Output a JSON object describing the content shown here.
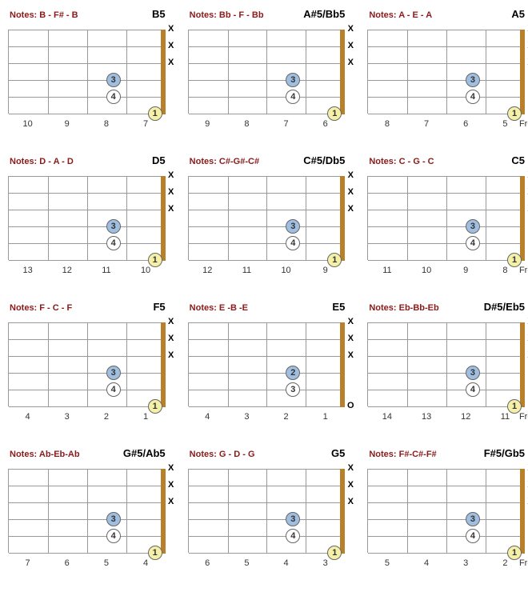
{
  "frets_label": "Frets",
  "chords": [
    {
      "notes": "Notes: B - F# - B",
      "name": "B5",
      "frets": [
        "10",
        "9",
        "8",
        "7"
      ],
      "endLabel": false,
      "open": null,
      "dots": [
        {
          "fret": 3,
          "string": 5,
          "finger": "4",
          "cls": "white"
        },
        {
          "fret": 3,
          "string": 4,
          "finger": "3",
          "cls": "blue"
        },
        {
          "fret": 0.15,
          "string": 6,
          "plus": false,
          "finger": "1",
          "cls": "yellow"
        }
      ],
      "mute": [
        1,
        2,
        3
      ]
    },
    {
      "notes": "Notes: Bb - F - Bb",
      "name": "A#5/Bb5",
      "frets": [
        "9",
        "8",
        "7",
        "6"
      ],
      "endLabel": false,
      "open": null,
      "dots": [
        {
          "fret": 3,
          "string": 5,
          "finger": "4",
          "cls": "white"
        },
        {
          "fret": 3,
          "string": 4,
          "finger": "3",
          "cls": "blue"
        },
        {
          "fret": 0.15,
          "string": 6,
          "plus": false,
          "finger": "1",
          "cls": "yellow"
        }
      ],
      "mute": [
        1,
        2,
        3
      ]
    },
    {
      "notes": "Notes: A - E - A",
      "name": "A5",
      "frets": [
        "8",
        "7",
        "6",
        "5"
      ],
      "endLabel": true,
      "open": null,
      "dots": [
        {
          "fret": 3,
          "string": 5,
          "finger": "4",
          "cls": "white"
        },
        {
          "fret": 3,
          "string": 4,
          "finger": "3",
          "cls": "blue"
        },
        {
          "fret": 0.15,
          "string": 6,
          "plus": false,
          "finger": "1",
          "cls": "yellow"
        }
      ],
      "mute": [
        1,
        2,
        3
      ]
    },
    {
      "notes": "Notes: D - A - D",
      "name": "D5",
      "frets": [
        "13",
        "12",
        "11",
        "10"
      ],
      "endLabel": false,
      "open": null,
      "dots": [
        {
          "fret": 3,
          "string": 5,
          "finger": "4",
          "cls": "white"
        },
        {
          "fret": 3,
          "string": 4,
          "finger": "3",
          "cls": "blue"
        },
        {
          "fret": 0.15,
          "string": 6,
          "plus": false,
          "finger": "1",
          "cls": "yellow"
        }
      ],
      "mute": [
        1,
        2,
        3
      ]
    },
    {
      "notes": "Notes: C#-G#-C#",
      "name": "C#5/Db5",
      "frets": [
        "12",
        "11",
        "10",
        "9"
      ],
      "endLabel": false,
      "open": null,
      "dots": [
        {
          "fret": 3,
          "string": 5,
          "finger": "4",
          "cls": "white"
        },
        {
          "fret": 3,
          "string": 4,
          "finger": "3",
          "cls": "blue"
        },
        {
          "fret": 0.15,
          "string": 6,
          "plus": false,
          "finger": "1",
          "cls": "yellow"
        }
      ],
      "mute": [
        1,
        2,
        3
      ]
    },
    {
      "notes": "Notes: C - G - C",
      "name": "C5",
      "frets": [
        "11",
        "10",
        "9",
        "8"
      ],
      "endLabel": true,
      "open": null,
      "dots": [
        {
          "fret": 3,
          "string": 5,
          "finger": "4",
          "cls": "white"
        },
        {
          "fret": 3,
          "string": 4,
          "finger": "3",
          "cls": "blue"
        },
        {
          "fret": 0.15,
          "string": 6,
          "plus": false,
          "finger": "1",
          "cls": "yellow"
        }
      ],
      "mute": [
        1,
        2,
        3
      ]
    },
    {
      "notes": "Notes: F - C - F",
      "name": "F5",
      "frets": [
        "4",
        "3",
        "2",
        "1"
      ],
      "endLabel": false,
      "open": null,
      "dots": [
        {
          "fret": 3,
          "string": 5,
          "finger": "4",
          "cls": "white"
        },
        {
          "fret": 3,
          "string": 4,
          "finger": "3",
          "cls": "blue"
        },
        {
          "fret": 0.15,
          "string": 6,
          "plus": false,
          "finger": "1",
          "cls": "yellow"
        }
      ],
      "mute": [
        1,
        2,
        3
      ]
    },
    {
      "notes": "Notes: E -B -E",
      "name": "E5",
      "frets": [
        "4",
        "3",
        "2",
        "1"
      ],
      "endLabel": false,
      "open": 6,
      "dots": [
        {
          "fret": 3,
          "string": 5,
          "finger": "3",
          "cls": "white"
        },
        {
          "fret": 3,
          "string": 4,
          "finger": "2",
          "cls": "blue"
        }
      ],
      "mute": [
        1,
        2,
        3
      ]
    },
    {
      "notes": "Notes: Eb-Bb-Eb",
      "name": "D#5/Eb5",
      "frets": [
        "14",
        "13",
        "12",
        "11"
      ],
      "endLabel": true,
      "open": null,
      "dots": [
        {
          "fret": 3,
          "string": 5,
          "finger": "4",
          "cls": "white"
        },
        {
          "fret": 3,
          "string": 4,
          "finger": "3",
          "cls": "blue"
        },
        {
          "fret": 0.15,
          "string": 6,
          "plus": false,
          "finger": "1",
          "cls": "yellow"
        }
      ],
      "mute": [
        1,
        2,
        3
      ]
    },
    {
      "notes": "Notes: Ab-Eb-Ab",
      "name": "G#5/Ab5",
      "frets": [
        "7",
        "6",
        "5",
        "4"
      ],
      "endLabel": false,
      "open": null,
      "dots": [
        {
          "fret": 3,
          "string": 5,
          "finger": "4",
          "cls": "white"
        },
        {
          "fret": 3,
          "string": 4,
          "finger": "3",
          "cls": "blue"
        },
        {
          "fret": 0.15,
          "string": 6,
          "plus": false,
          "finger": "1",
          "cls": "yellow"
        }
      ],
      "mute": [
        1,
        2,
        3
      ]
    },
    {
      "notes": "Notes: G - D - G",
      "name": "G5",
      "frets": [
        "6",
        "5",
        "4",
        "3"
      ],
      "endLabel": false,
      "open": null,
      "dots": [
        {
          "fret": 3,
          "string": 5,
          "finger": "4",
          "cls": "white"
        },
        {
          "fret": 3,
          "string": 4,
          "finger": "3",
          "cls": "blue"
        },
        {
          "fret": 0.15,
          "string": 6,
          "plus": false,
          "finger": "1",
          "cls": "yellow"
        }
      ],
      "mute": [
        1,
        2,
        3
      ]
    },
    {
      "notes": "Notes: F#-C#-F#",
      "name": "F#5/Gb5",
      "frets": [
        "5",
        "4",
        "3",
        "2"
      ],
      "endLabel": true,
      "open": null,
      "dots": [
        {
          "fret": 3,
          "string": 5,
          "finger": "4",
          "cls": "white"
        },
        {
          "fret": 3,
          "string": 4,
          "finger": "3",
          "cls": "blue"
        },
        {
          "fret": 0.15,
          "string": 6,
          "plus": false,
          "finger": "1",
          "cls": "yellow"
        }
      ],
      "mute": [
        1,
        2,
        3
      ]
    }
  ]
}
